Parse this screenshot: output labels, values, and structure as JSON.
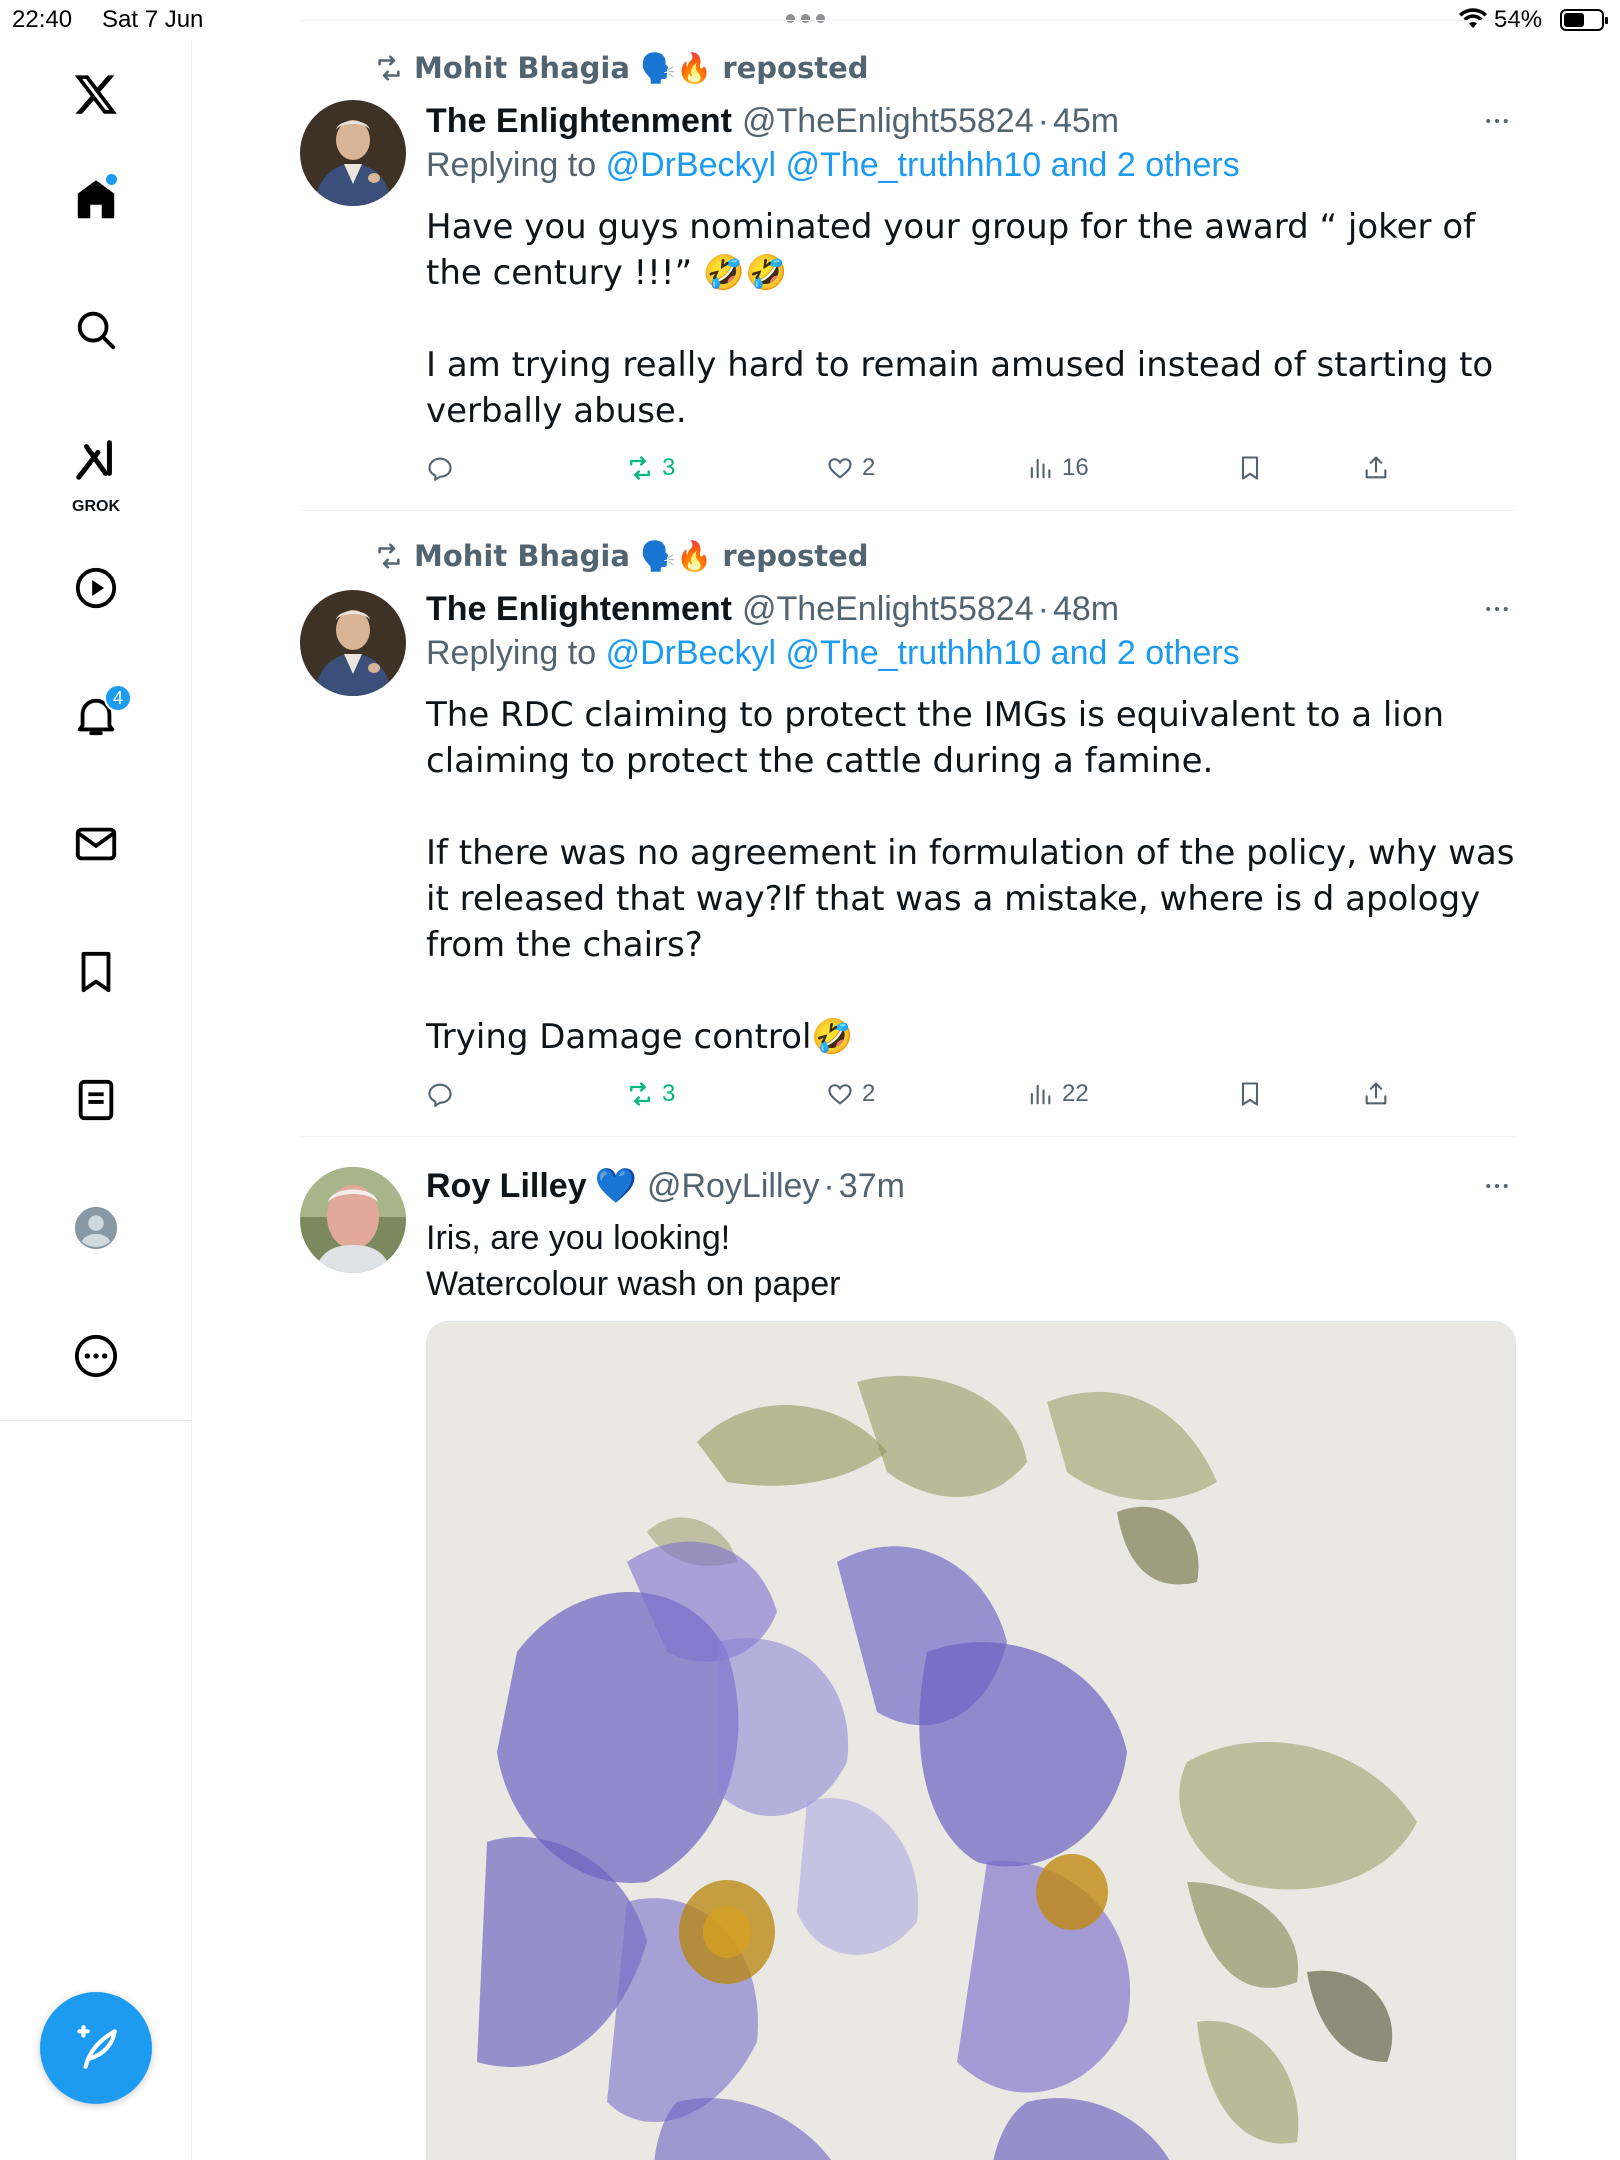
{
  "status_bar": {
    "time": "22:40",
    "date": "Sat 7 Jun",
    "battery": "54%",
    "battery_level": 0.54
  },
  "sidebar": {
    "logo": "x-logo-icon",
    "items": [
      {
        "name": "home",
        "icon": "home-icon",
        "has_dot": true
      },
      {
        "name": "explore",
        "icon": "search-icon"
      },
      {
        "name": "grok",
        "icon": "grok-icon",
        "label": "GROK"
      },
      {
        "name": "video",
        "icon": "play-icon"
      },
      {
        "name": "notifications",
        "icon": "bell-icon",
        "badge": "4"
      },
      {
        "name": "messages",
        "icon": "mail-icon"
      },
      {
        "name": "bookmarks",
        "icon": "bookmark-icon"
      },
      {
        "name": "lists",
        "icon": "list-icon"
      },
      {
        "name": "profile",
        "icon": "profile-icon"
      },
      {
        "name": "more",
        "icon": "more-circle-icon"
      }
    ],
    "compose_icon": "compose-icon"
  },
  "tweets": [
    {
      "repost_by": "Mohit Bhagia 🗣️🔥 reposted",
      "name": "The Enlightenment",
      "handle": "@TheEnlight55824",
      "dot": "·",
      "time": "45m",
      "replying_prefix": "Replying to",
      "replying_to": "@DrBeckyl @The_truthhh10 and 2 others",
      "text": "Have you guys nominated your group for the award “ joker of the century !!!” 🤣🤣\n\nI am trying really hard to remain amused instead of starting to verbally abuse.",
      "reposts": "3",
      "likes": "2",
      "views": "16"
    },
    {
      "repost_by": "Mohit Bhagia 🗣️🔥 reposted",
      "name": "The Enlightenment",
      "handle": "@TheEnlight55824",
      "dot": "·",
      "time": "48m",
      "replying_prefix": "Replying to",
      "replying_to": "@DrBeckyl @The_truthhh10 and 2 others",
      "text": "The RDC claiming to protect the IMGs is equivalent to a lion claiming to protect the cattle during a famine.\n\nIf there was no agreement in formulation of the policy, why was it released that way?If that was a mistake, where is d apology from the chairs?\n\nTrying Damage control🤣",
      "reposts": "3",
      "likes": "2",
      "views": "22"
    },
    {
      "name": "Roy Lilley",
      "verified_emoji": "💙",
      "handle": "@RoyLilley",
      "dot": "·",
      "time": "37m",
      "text": "Iris, are you looking!\nWatercolour wash on paper",
      "media": "watercolour-iris-painting"
    }
  ]
}
